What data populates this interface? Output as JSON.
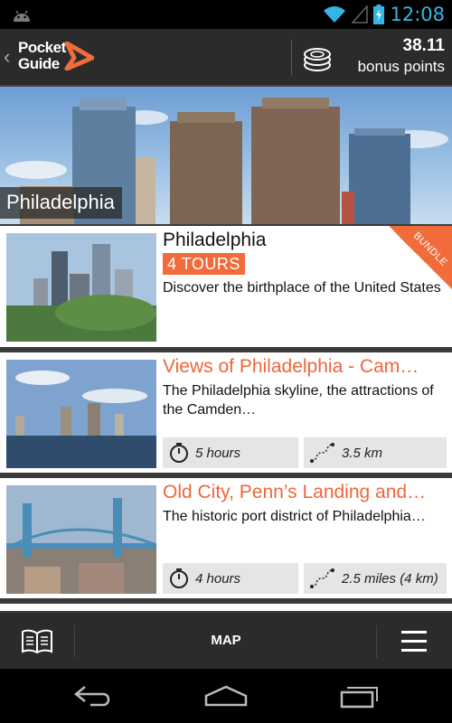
{
  "status_bar": {
    "time": "12:08"
  },
  "action_bar": {
    "logo_line1": "Pocket",
    "logo_line2": "Guide",
    "bonus_points_value": "38.11",
    "bonus_points_label": "bonus points"
  },
  "hero": {
    "title": "Philadelphia"
  },
  "bundle_card": {
    "title": "Philadelphia",
    "tours_badge": "4 TOURS",
    "ribbon": "BUNDLE",
    "description": "Discover the birthplace of the United States"
  },
  "tours": [
    {
      "title": "Views of Philadelphia - Cam…",
      "description": "The Philadelphia skyline, the attractions of the Camden…",
      "duration": "5 hours",
      "distance": "3.5 km"
    },
    {
      "title": "Old City, Penn’s Landing and…",
      "description": "The historic port district of Philadelphia…",
      "duration": "4 hours",
      "distance": "2.5 miles (4 km)"
    }
  ],
  "bottom_bar": {
    "map_label": "MAP"
  },
  "colors": {
    "accent": "#f26b3a",
    "status_blue": "#33b5e5",
    "bar_dark": "#2b2b2b"
  }
}
